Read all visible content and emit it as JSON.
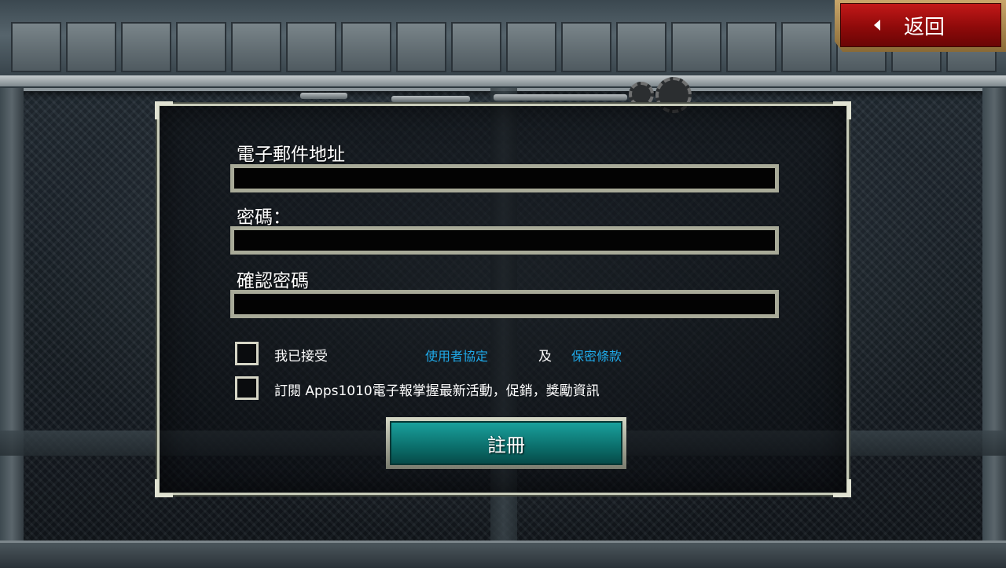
{
  "header": {
    "back_label": "返回"
  },
  "form": {
    "email_label": "電子郵件地址",
    "email_value": "",
    "password_label": "密碼：",
    "password_value": "",
    "confirm_label": "確認密碼",
    "confirm_value": ""
  },
  "agreements": {
    "accept_prefix": "我已接受",
    "terms_link": "使用者協定",
    "and_text": "及",
    "privacy_link": "保密條款",
    "subscribe_text": "訂閱 Apps1010電子報掌握最新活動，促銷，獎勵資訊",
    "accept_checked": false,
    "subscribe_checked": false
  },
  "actions": {
    "register_label": "註冊"
  },
  "colors": {
    "link": "#1fa9e8",
    "register_button": "#0b6e6b",
    "back_button": "#b01010"
  },
  "icons": {
    "back": "left-triangle-icon"
  }
}
